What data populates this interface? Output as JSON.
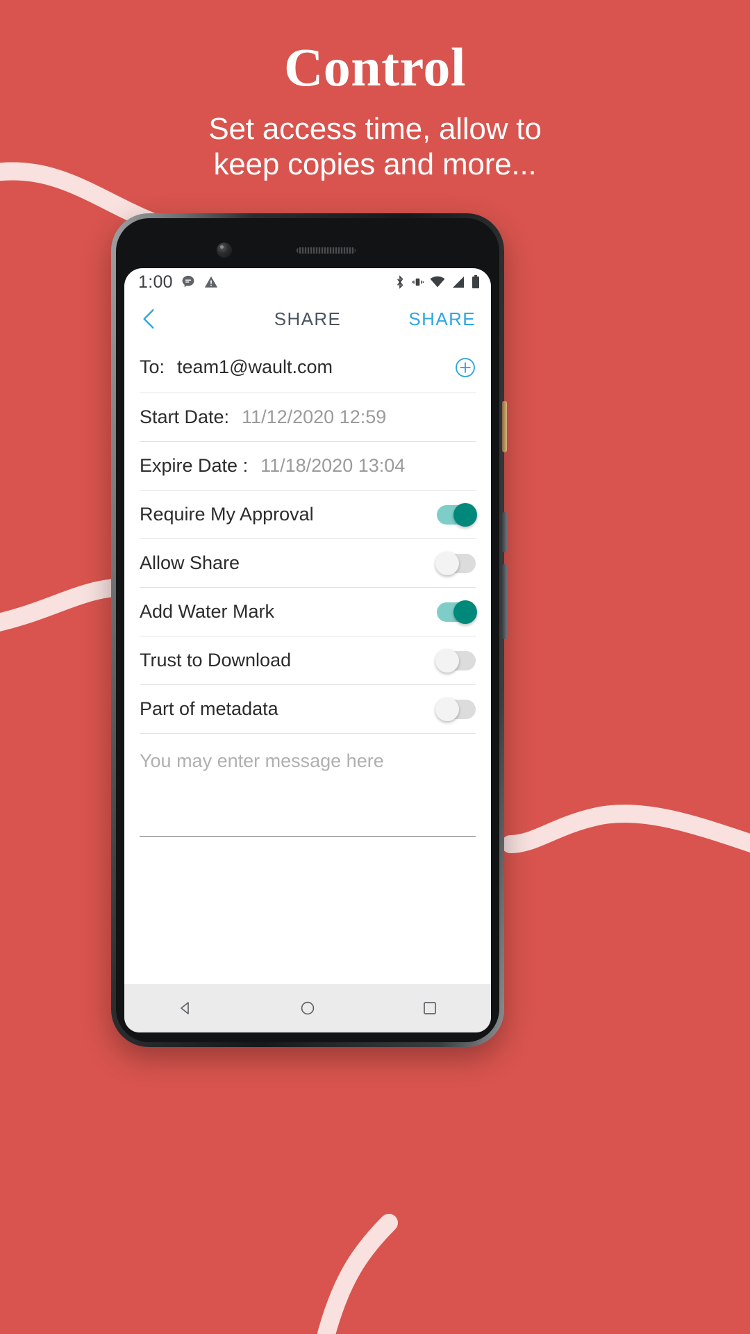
{
  "promo": {
    "title": "Control",
    "subtitle_line1": "Set access time, allow to",
    "subtitle_line2": "keep copies and more...",
    "background_color": "#d9544e",
    "text_color": "#ffffff"
  },
  "phone": {
    "statusbar": {
      "time": "1:00",
      "left_icons": [
        "message-bubble-icon",
        "warning-triangle-icon"
      ],
      "right_icons": [
        "bluetooth-icon",
        "vibrate-icon",
        "wifi-icon",
        "cellular-signal-icon",
        "battery-icon"
      ]
    },
    "appbar": {
      "back_icon": "chevron-left-icon",
      "title": "SHARE",
      "action_label": "SHARE",
      "accent_color": "#2ea7e0"
    },
    "form": {
      "to": {
        "label": "To:",
        "value": "team1@wault.com",
        "add_icon": "plus-circle-icon"
      },
      "start_date": {
        "label": "Start Date:",
        "value": "11/12/2020 12:59"
      },
      "expire_date": {
        "label": "Expire Date :",
        "value": "11/18/2020 13:04"
      },
      "toggles": [
        {
          "label": "Require My Approval",
          "state": "on"
        },
        {
          "label": "Allow Share",
          "state": "off"
        },
        {
          "label": "Add Water Mark",
          "state": "on"
        },
        {
          "label": "Trust to Download",
          "state": "off"
        },
        {
          "label": "Part of metadata",
          "state": "off"
        }
      ],
      "message": {
        "placeholder": "You may enter message here",
        "value": ""
      },
      "toggle_on_color": "#00897b",
      "toggle_off_color": "#dcdcdc"
    },
    "navbar": {
      "items": [
        "back-triangle-icon",
        "home-circle-icon",
        "recents-square-icon"
      ]
    }
  }
}
